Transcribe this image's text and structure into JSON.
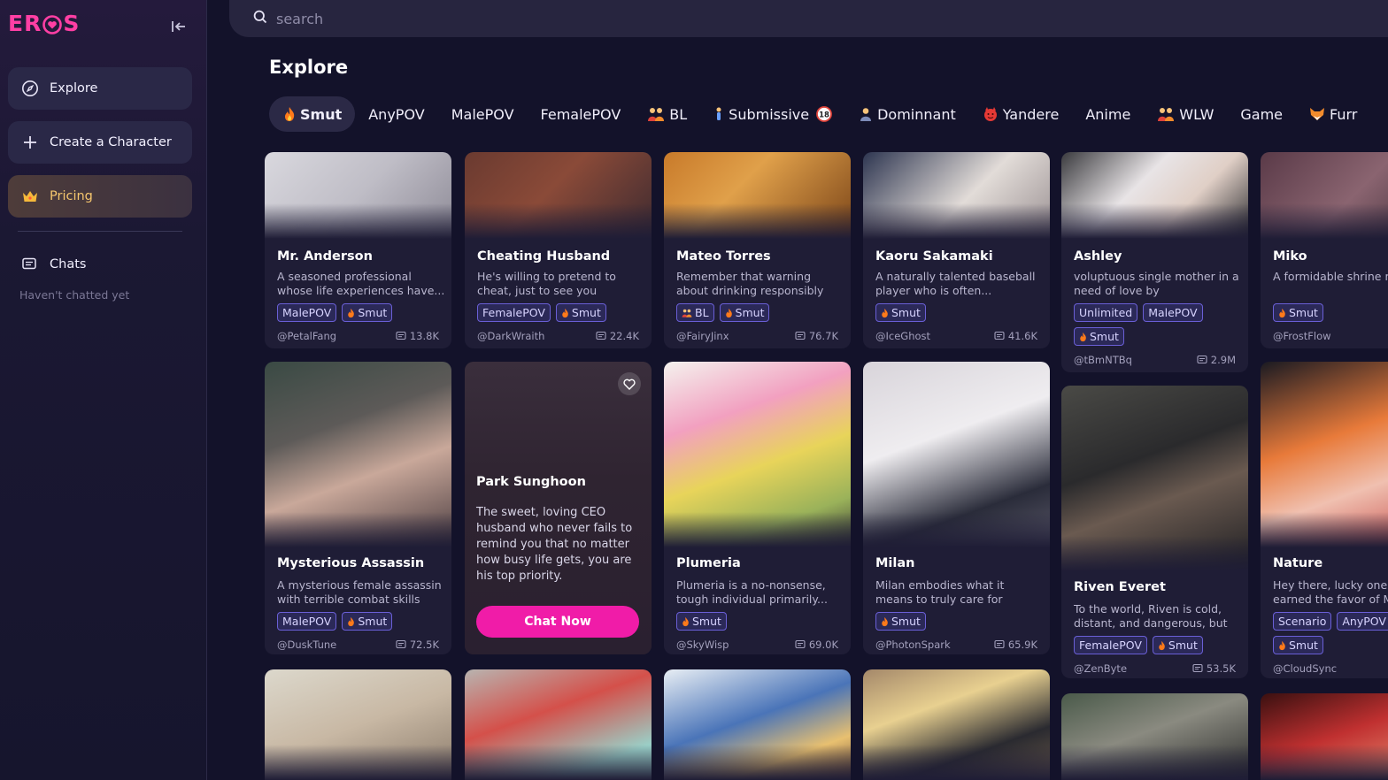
{
  "app": {
    "logo_text_left": "ER",
    "logo_text_right": "S",
    "brand_color": "#ff3fa4"
  },
  "sidebar": {
    "items": [
      {
        "label": "Explore",
        "icon": "compass-icon"
      },
      {
        "label": "Create a Character",
        "icon": "plus-icon"
      },
      {
        "label": "Pricing",
        "icon": "crown-icon"
      }
    ],
    "chats_label": "Chats",
    "chats_empty": "Haven't chatted yet"
  },
  "search": {
    "placeholder": "search"
  },
  "page": {
    "title": "Explore"
  },
  "tabs": [
    {
      "label": "Smut",
      "icon": "flame-icon",
      "active": true
    },
    {
      "label": "AnyPOV"
    },
    {
      "label": "MalePOV"
    },
    {
      "label": "FemalePOV"
    },
    {
      "label": "BL",
      "icon": "couple-icon"
    },
    {
      "label": "Submissive",
      "icon": "person-icon",
      "badge": "18"
    },
    {
      "label": "Dominnant",
      "icon": "person-icon"
    },
    {
      "label": "Yandere",
      "icon": "devil-icon"
    },
    {
      "label": "Anime"
    },
    {
      "label": "WLW",
      "icon": "couple-icon"
    },
    {
      "label": "Game"
    },
    {
      "label": "Furr",
      "icon": "fox-icon"
    }
  ],
  "cards": [
    {
      "name": "Mr. Anderson",
      "desc": "A seasoned professional whose life experiences have...",
      "tags": [
        "MalePOV",
        "Smut"
      ],
      "creator": "@PetalFang",
      "count": "13.8K"
    },
    {
      "name": "Cheating Husband",
      "desc": "He's willing to pretend to cheat, just to see you jealous...",
      "tags": [
        "FemalePOV",
        "Smut"
      ],
      "creator": "@DarkWraith",
      "count": "22.4K"
    },
    {
      "name": "Mateo Torres",
      "desc": "Remember that warning about drinking responsibly or...",
      "tags": [
        "BL",
        "Smut"
      ],
      "creator": "@FairyJinx",
      "count": "76.7K"
    },
    {
      "name": "Kaoru Sakamaki",
      "desc": "A naturally talented baseball player who is often...",
      "tags": [
        "Smut"
      ],
      "creator": "@IceGhost",
      "count": "41.6K"
    },
    {
      "name": "Ashley",
      "desc": "voluptuous single mother in a need of love by anyone(even...",
      "tags": [
        "Unlimited",
        "MalePOV",
        "Smut"
      ],
      "creator": "@tBmNTBq",
      "count": "2.9M"
    },
    {
      "name": "Miko",
      "desc": "A formidable shrine m leader armed with an",
      "tags": [
        "Smut"
      ],
      "creator": "@FrostFlow",
      "count": ""
    },
    {
      "name": "Mysterious Assassin",
      "desc": "A mysterious female assassin with terrible combat skills bu...",
      "tags": [
        "MalePOV",
        "Smut"
      ],
      "creator": "@DuskTune",
      "count": "72.5K"
    },
    {
      "name": "Plumeria",
      "desc": "Plumeria is a no-nonsense, tough individual primarily...",
      "tags": [
        "Smut"
      ],
      "creator": "@SkyWisp",
      "count": "69.0K"
    },
    {
      "name": "Milan",
      "desc": "Milan embodies what it means to truly care for someone...",
      "tags": [
        "Smut"
      ],
      "creator": "@PhotonSpark",
      "count": "65.9K"
    },
    {
      "name": "Riven Everet",
      "desc": "To the world, Riven is cold, distant, and dangerous, but t...",
      "tags": [
        "FemalePOV",
        "Smut"
      ],
      "creator": "@ZenByte",
      "count": "53.5K"
    },
    {
      "name": "Nature",
      "desc": "Hey there, lucky one!\" earned the favor of M",
      "tags": [
        "Scenario",
        "AnyPOV",
        "Smut"
      ],
      "creator": "@CloudSync",
      "count": ""
    }
  ],
  "hover_card": {
    "name": "Park Sunghoon",
    "desc": "The sweet, loving CEO husband who never fails to remind you that no matter how busy life gets, you are his top priority.",
    "button": "Chat Now"
  }
}
